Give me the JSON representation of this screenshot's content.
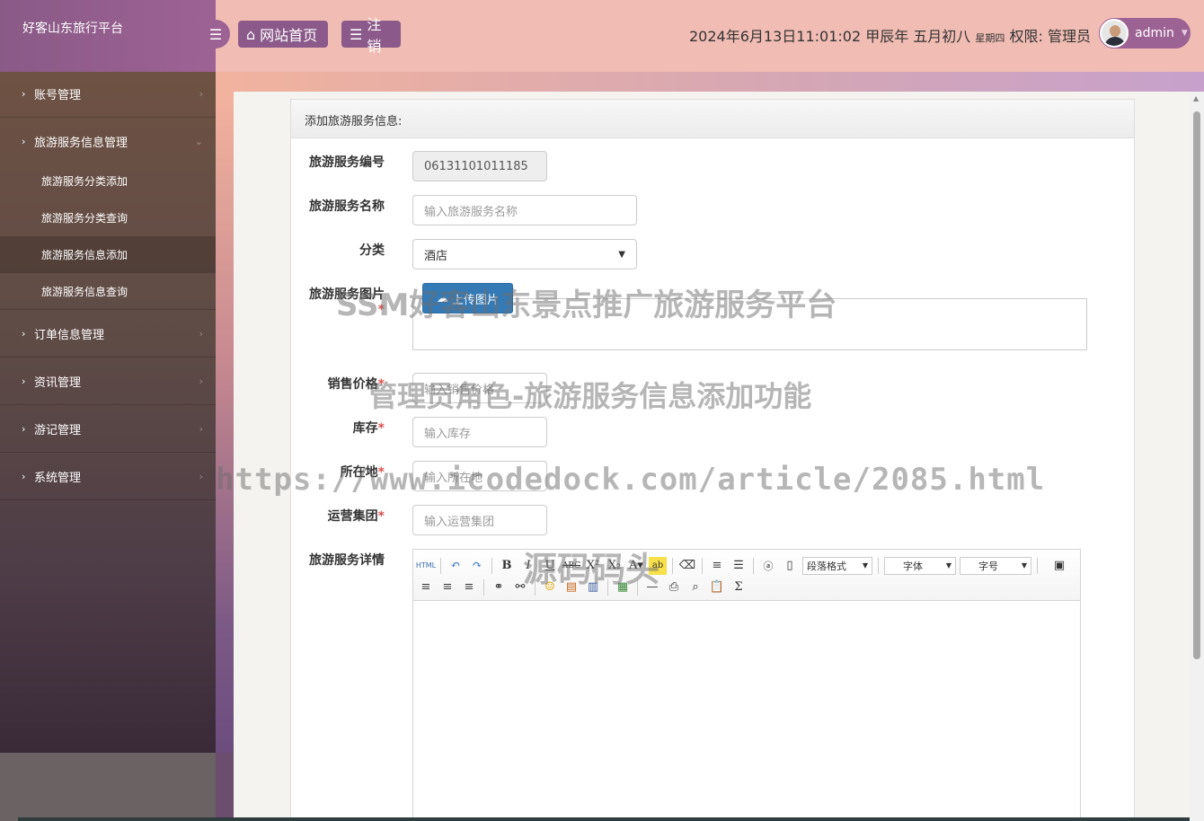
{
  "app": {
    "title": "好客山东旅行平台"
  },
  "header": {
    "home_label": "网站首页",
    "logout_label": "注销",
    "datetime": "2024年6月13日11:01:02 甲辰年 五月初八",
    "weekday": "星期四",
    "permission": "权限: 管理员",
    "username": "admin"
  },
  "sidebar": {
    "items": [
      {
        "label": "账号管理"
      },
      {
        "label": "旅游服务信息管理"
      },
      {
        "label": "订单信息管理"
      },
      {
        "label": "资讯管理"
      },
      {
        "label": "游记管理"
      },
      {
        "label": "系统管理"
      }
    ],
    "subitems": [
      {
        "label": "旅游服务分类添加"
      },
      {
        "label": "旅游服务分类查询"
      },
      {
        "label": "旅游服务信息添加",
        "active": true
      },
      {
        "label": "旅游服务信息查询"
      }
    ]
  },
  "form": {
    "title": "添加旅游服务信息:",
    "code_label": "旅游服务编号",
    "code_value": "06131101011185",
    "name_label": "旅游服务名称",
    "name_placeholder": "输入旅游服务名称",
    "category_label": "分类",
    "category_value": "酒店",
    "image_label": "旅游服务图片",
    "upload_label": "上传图片",
    "price_label": "销售价格",
    "price_placeholder": "输入销售价格",
    "stock_label": "库存",
    "stock_placeholder": "输入库存",
    "location_label": "所在地",
    "location_placeholder": "输入所在地",
    "group_label": "运营集团",
    "group_placeholder": "输入运营集团",
    "detail_label": "旅游服务详情",
    "required_mark": "*"
  },
  "editor": {
    "paragraph_format": "段落格式",
    "font_family": "字体",
    "font_size": "字号"
  },
  "watermarks": {
    "line1": "SSM好客山东景点推广旅游服务平台",
    "line2": "管理员角色-旅游服务信息添加功能",
    "line3": "https://www.icodedock.com/article/2085.html",
    "line4": "源码码头"
  }
}
